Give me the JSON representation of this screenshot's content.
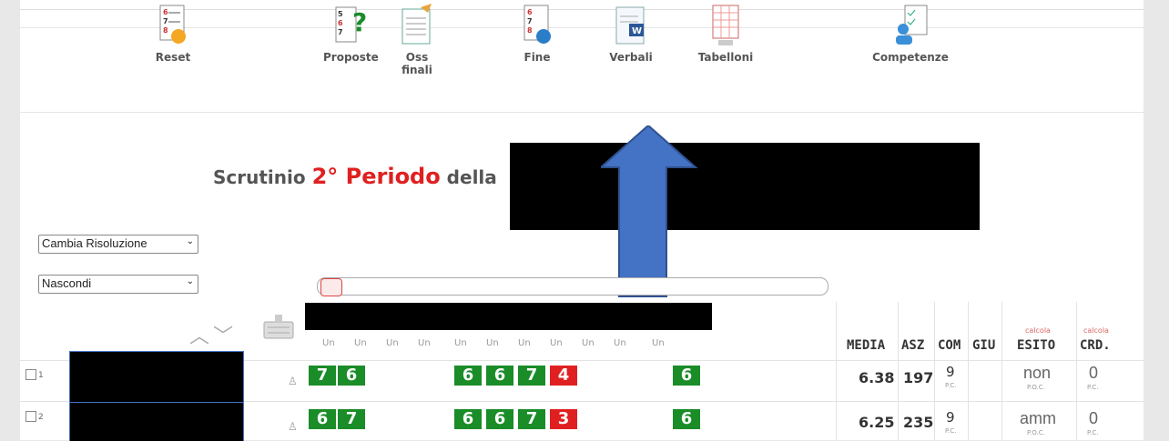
{
  "toolbar": {
    "items": [
      {
        "id": "reset",
        "label": "Reset"
      },
      {
        "id": "proposte",
        "label": "Proposte"
      },
      {
        "id": "oss_finali",
        "label": "Oss finali"
      },
      {
        "id": "fine",
        "label": "Fine"
      },
      {
        "id": "verbali",
        "label": "Verbali"
      },
      {
        "id": "tabelloni",
        "label": "Tabelloni"
      },
      {
        "id": "competenze",
        "label": "Competenze"
      }
    ]
  },
  "title": {
    "prefix": "Scrutinio ",
    "highlight": "2° Periodo",
    "suffix": " della"
  },
  "controls": {
    "resolution_select": "Cambia Risoluzione",
    "visibility_select": "Nascondi"
  },
  "columns": [
    "Un",
    "Un",
    "Un",
    "Un",
    "Un",
    "Un",
    "Un",
    "Un",
    "Un",
    "Un",
    "Un"
  ],
  "summary_headers": {
    "media": "MEDIA",
    "asz": "ASZ",
    "com": "COM",
    "giu": "GIU",
    "esito": "ESITO",
    "crd": "CRD.",
    "calc": "calcola"
  },
  "rows": [
    {
      "num": "1",
      "grades": [
        "7",
        "6",
        "",
        "",
        "6",
        "6",
        "7",
        "4",
        "",
        "",
        "6"
      ],
      "media": "6.38",
      "asz": "197",
      "com": "9",
      "esito": "non",
      "crd": "0",
      "sub_com": "P.C.",
      "sub_esito": "P.O.C.",
      "sub_crd": "P.C."
    },
    {
      "num": "2",
      "grades": [
        "6",
        "7",
        "",
        "",
        "6",
        "6",
        "7",
        "3",
        "",
        "",
        "6"
      ],
      "media": "6.25",
      "asz": "235",
      "com": "9",
      "esito": "amm",
      "crd": "0",
      "sub_com": "P.C.",
      "sub_esito": "P.O.C.",
      "sub_crd": "P.C."
    }
  ],
  "colors": {
    "pass": "#1a8c28",
    "fail": "#e02020",
    "accent_arrow": "#4472c4"
  }
}
